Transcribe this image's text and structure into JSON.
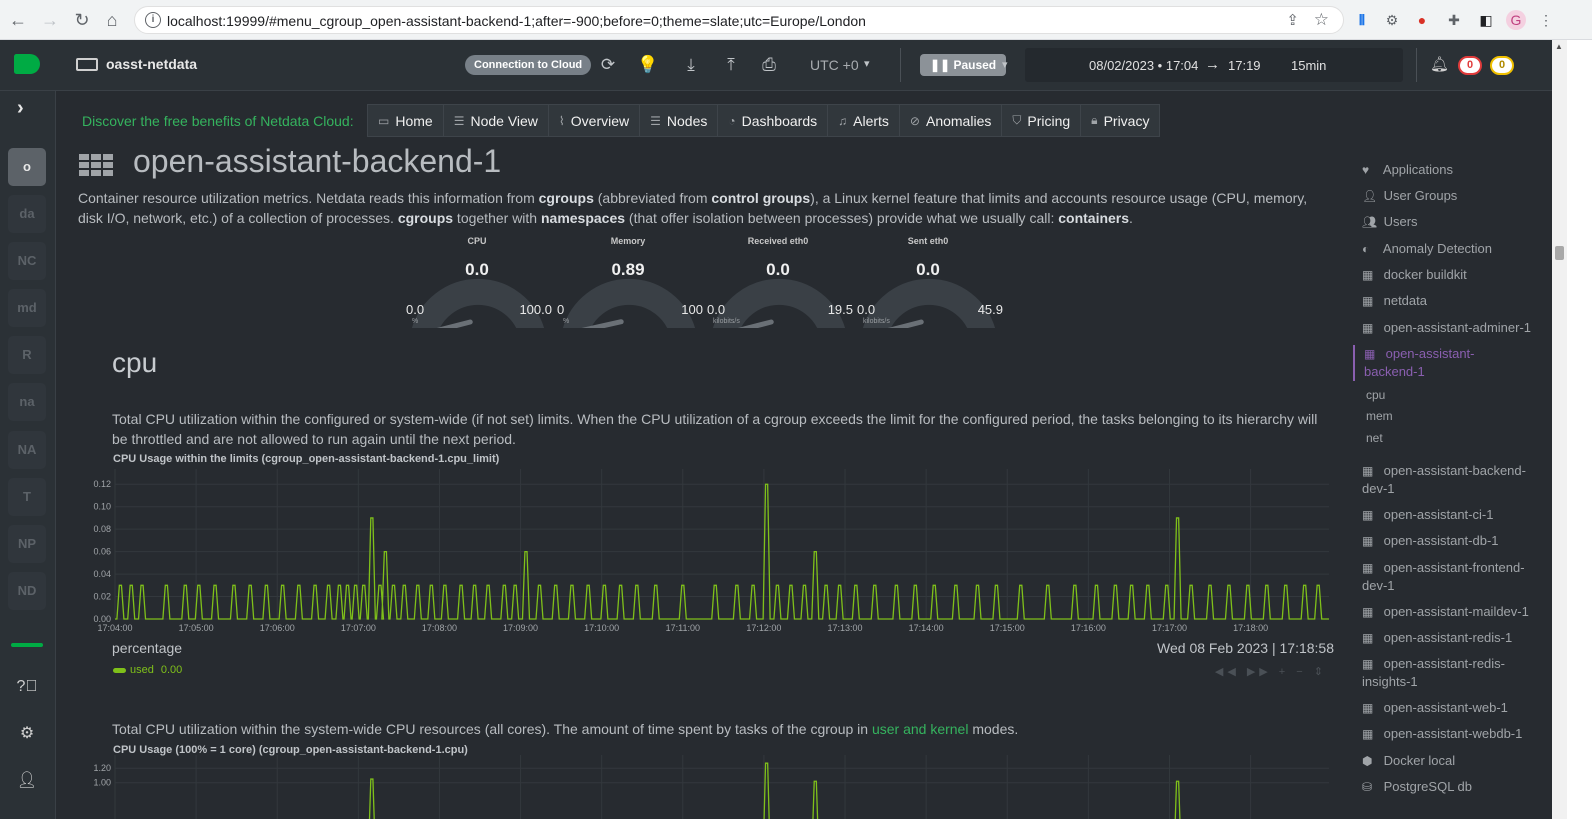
{
  "browser": {
    "url": "localhost:19999/#menu_cgroup_open-assistant-backend-1;after=-900;before=0;theme=slate;utc=Europe/London",
    "back_icon": "arrow-left-icon",
    "forward_icon": "arrow-right-icon",
    "reload_icon": "reload-icon",
    "home_icon": "home-icon"
  },
  "header": {
    "hostname": "oasst-netdata",
    "cloud_button": "Connection to Cloud",
    "timezone": "UTC +0",
    "paused_label": "Paused",
    "date_from": "08/02/2023 • 17:04",
    "arrow": "→",
    "date_to": "17:19",
    "duration": "15min",
    "alerts_critical": "0",
    "alerts_warning": "0"
  },
  "left_sidebar": {
    "nodes": [
      "o",
      "da",
      "NC",
      "md",
      "R",
      "na",
      "NA",
      "T",
      "NP",
      "ND"
    ]
  },
  "promo": "Discover the free benefits of Netdata Cloud:",
  "top_nav": [
    {
      "label": "Home",
      "icon": "monitor-icon"
    },
    {
      "label": "Node View",
      "icon": "server-icon"
    },
    {
      "label": "Overview",
      "icon": "chart-icon"
    },
    {
      "label": "Nodes",
      "icon": "nodes-icon"
    },
    {
      "label": "Dashboards",
      "icon": "dashboard-icon"
    },
    {
      "label": "Alerts",
      "icon": "bell-icon"
    },
    {
      "label": "Anomalies",
      "icon": "anomaly-icon"
    },
    {
      "label": "Pricing",
      "icon": "shield-icon"
    },
    {
      "label": "Privacy",
      "icon": "lock-icon"
    }
  ],
  "section": {
    "title": "open-assistant-backend-1",
    "desc_1": "Container resource utilization metrics. Netdata reads this information from ",
    "desc_b1": "cgroups",
    "desc_2": " (abbreviated from ",
    "desc_b2": "control groups",
    "desc_3": "), a Linux kernel feature that limits and accounts resource usage (CPU, memory, disk I/O, network, etc.) of a collection of processes. ",
    "desc_b3": "cgroups",
    "desc_4": " together with ",
    "desc_b4": "namespaces",
    "desc_5": " (that offer isolation between processes) provide what we usually call: ",
    "desc_b5": "containers",
    "desc_6": "."
  },
  "gauges": [
    {
      "title": "CPU",
      "value": "0.0",
      "min": "0.0",
      "max": "100.0",
      "unit": "%",
      "fill": 0.0
    },
    {
      "title": "Memory",
      "value": "0.89",
      "min": "0",
      "max": "100",
      "unit": "%",
      "fill": 0.0089
    },
    {
      "title": "Received eth0",
      "value": "0.0",
      "min": "0.0",
      "max": "19.5",
      "unit": "kilobits/s",
      "fill": 0.0
    },
    {
      "title": "Sent eth0",
      "value": "0.0",
      "min": "0.0",
      "max": "45.9",
      "unit": "kilobits/s",
      "fill": 0.0
    }
  ],
  "cpu_heading": "cpu",
  "chart1": {
    "desc": "Total CPU utilization within the configured or system-wide (if not set) limits. When the CPU utilization of a cgroup exceeds the limit for the configured period, the tasks belonging to its hierarchy will be throttled and are not allowed to run again until the next period.",
    "title": "CPU Usage within the limits (cgroup_open-assistant-backend-1.cpu_limit)",
    "unit": "percentage",
    "timestamp": "Wed 08 Feb 2023 | 17:18:58",
    "series_label": "used",
    "series_value": "0.00",
    "tools": "◀◀ ▶▶ + − ⇕"
  },
  "chart2": {
    "desc_1": "Total CPU utilization within the system-wide CPU resources (all cores). The amount of time spent by tasks of the cgroup in ",
    "desc_link": "user and kernel",
    "desc_2": " modes.",
    "title": "CPU Usage (100% = 1 core) (cgroup_open-assistant-backend-1.cpu)"
  },
  "chart_data": [
    {
      "type": "line",
      "title": "CPU Usage within the limits (cgroup_open-assistant-backend-1.cpu_limit)",
      "ylabel": "percentage",
      "ylim": [
        0,
        0.13
      ],
      "y_ticks": [
        "0.12",
        "0.10",
        "0.08",
        "0.06",
        "0.04",
        "0.02",
        "0.00"
      ],
      "x_ticks": [
        "17:04:00",
        "17:05:00",
        "17:06:00",
        "17:07:00",
        "17:08:00",
        "17:09:00",
        "17:10:00",
        "17:11:00",
        "17:12:00",
        "17:13:00",
        "17:14:00",
        "17:15:00",
        "17:16:00",
        "17:17:00",
        "17:18:00"
      ],
      "grid": true,
      "series": [
        {
          "name": "used",
          "color": "#7fc01a",
          "spikes": [
            {
              "t": "17:04:04",
              "v": 0.03
            },
            {
              "t": "17:04:12",
              "v": 0.03
            },
            {
              "t": "17:04:20",
              "v": 0.03
            },
            {
              "t": "17:04:38",
              "v": 0.03
            },
            {
              "t": "17:04:52",
              "v": 0.03
            },
            {
              "t": "17:05:02",
              "v": 0.03
            },
            {
              "t": "17:05:14",
              "v": 0.03
            },
            {
              "t": "17:05:28",
              "v": 0.03
            },
            {
              "t": "17:05:40",
              "v": 0.03
            },
            {
              "t": "17:05:52",
              "v": 0.03
            },
            {
              "t": "17:06:04",
              "v": 0.03
            },
            {
              "t": "17:06:16",
              "v": 0.03
            },
            {
              "t": "17:06:28",
              "v": 0.03
            },
            {
              "t": "17:06:38",
              "v": 0.03
            },
            {
              "t": "17:06:46",
              "v": 0.03
            },
            {
              "t": "17:06:52",
              "v": 0.03
            },
            {
              "t": "17:06:58",
              "v": 0.03
            },
            {
              "t": "17:07:04",
              "v": 0.03
            },
            {
              "t": "17:07:10",
              "v": 0.09
            },
            {
              "t": "17:07:16",
              "v": 0.03
            },
            {
              "t": "17:07:20",
              "v": 0.06
            },
            {
              "t": "17:07:26",
              "v": 0.03
            },
            {
              "t": "17:07:34",
              "v": 0.03
            },
            {
              "t": "17:07:44",
              "v": 0.03
            },
            {
              "t": "17:07:54",
              "v": 0.03
            },
            {
              "t": "17:08:04",
              "v": 0.03
            },
            {
              "t": "17:08:16",
              "v": 0.03
            },
            {
              "t": "17:08:26",
              "v": 0.03
            },
            {
              "t": "17:08:36",
              "v": 0.03
            },
            {
              "t": "17:08:48",
              "v": 0.03
            },
            {
              "t": "17:08:56",
              "v": 0.03
            },
            {
              "t": "17:09:04",
              "v": 0.06
            },
            {
              "t": "17:09:14",
              "v": 0.03
            },
            {
              "t": "17:09:26",
              "v": 0.03
            },
            {
              "t": "17:09:38",
              "v": 0.03
            },
            {
              "t": "17:09:50",
              "v": 0.03
            },
            {
              "t": "17:10:02",
              "v": 0.03
            },
            {
              "t": "17:10:14",
              "v": 0.03
            },
            {
              "t": "17:10:26",
              "v": 0.03
            },
            {
              "t": "17:10:40",
              "v": 0.03
            },
            {
              "t": "17:11:00",
              "v": 0.03
            },
            {
              "t": "17:11:24",
              "v": 0.03
            },
            {
              "t": "17:11:40",
              "v": 0.03
            },
            {
              "t": "17:11:52",
              "v": 0.03
            },
            {
              "t": "17:12:02",
              "v": 0.12
            },
            {
              "t": "17:12:10",
              "v": 0.03
            },
            {
              "t": "17:12:20",
              "v": 0.03
            },
            {
              "t": "17:12:30",
              "v": 0.03
            },
            {
              "t": "17:12:38",
              "v": 0.06
            },
            {
              "t": "17:12:46",
              "v": 0.03
            },
            {
              "t": "17:12:56",
              "v": 0.03
            },
            {
              "t": "17:13:08",
              "v": 0.03
            },
            {
              "t": "17:13:22",
              "v": 0.03
            },
            {
              "t": "17:13:38",
              "v": 0.03
            },
            {
              "t": "17:13:52",
              "v": 0.03
            },
            {
              "t": "17:14:06",
              "v": 0.03
            },
            {
              "t": "17:14:22",
              "v": 0.03
            },
            {
              "t": "17:14:38",
              "v": 0.03
            },
            {
              "t": "17:14:52",
              "v": 0.03
            },
            {
              "t": "17:15:10",
              "v": 0.03
            },
            {
              "t": "17:15:30",
              "v": 0.03
            },
            {
              "t": "17:15:50",
              "v": 0.03
            },
            {
              "t": "17:16:06",
              "v": 0.03
            },
            {
              "t": "17:16:20",
              "v": 0.03
            },
            {
              "t": "17:16:32",
              "v": 0.03
            },
            {
              "t": "17:16:44",
              "v": 0.03
            },
            {
              "t": "17:16:58",
              "v": 0.03
            },
            {
              "t": "17:17:06",
              "v": 0.09
            },
            {
              "t": "17:17:16",
              "v": 0.03
            },
            {
              "t": "17:17:30",
              "v": 0.03
            },
            {
              "t": "17:17:44",
              "v": 0.03
            },
            {
              "t": "17:17:58",
              "v": 0.03
            },
            {
              "t": "17:18:12",
              "v": 0.03
            },
            {
              "t": "17:18:26",
              "v": 0.03
            },
            {
              "t": "17:18:40",
              "v": 0.03
            },
            {
              "t": "17:18:50",
              "v": 0.03
            }
          ]
        }
      ]
    },
    {
      "type": "line",
      "title": "CPU Usage (100% = 1 core) (cgroup_open-assistant-backend-1.cpu)",
      "y_ticks": [
        "1.20",
        "1.00"
      ],
      "ylim": [
        0,
        1.3
      ],
      "grid": true,
      "series": [
        {
          "color": "#7fc01a",
          "spikes": [
            {
              "t": "17:07:10",
              "v": 1.05
            },
            {
              "t": "17:12:02",
              "v": 1.27
            },
            {
              "t": "17:12:38",
              "v": 1.02
            },
            {
              "t": "17:17:06",
              "v": 1.02
            }
          ]
        }
      ]
    }
  ],
  "right_sidebar": {
    "items": [
      {
        "label": "Applications",
        "icon": "heart-icon"
      },
      {
        "label": "User Groups",
        "icon": "user-icon"
      },
      {
        "label": "Users",
        "icon": "users-icon"
      },
      {
        "label": "Anomaly Detection",
        "icon": "anomaly-icon"
      },
      {
        "label": "docker buildkit",
        "icon": "grid-icon"
      },
      {
        "label": "netdata",
        "icon": "grid-icon"
      },
      {
        "label": "open-assistant-adminer-1",
        "icon": "grid-icon"
      }
    ],
    "active_line1": "open-assistant-",
    "active_line2": "backend-1",
    "sub_items": [
      "cpu",
      "mem",
      "net"
    ],
    "items2": [
      {
        "l1": "open-assistant-backend-",
        "l2": "dev-1"
      },
      {
        "l1": "open-assistant-ci-1",
        "l2": ""
      },
      {
        "l1": "open-assistant-db-1",
        "l2": ""
      },
      {
        "l1": "open-assistant-frontend-",
        "l2": "dev-1"
      },
      {
        "l1": "open-assistant-maildev-1",
        "l2": ""
      },
      {
        "l1": "open-assistant-redis-1",
        "l2": ""
      },
      {
        "l1": "open-assistant-redis-",
        "l2": "insights-1"
      },
      {
        "l1": "open-assistant-web-1",
        "l2": ""
      },
      {
        "l1": "open-assistant-webdb-1",
        "l2": ""
      }
    ],
    "items3": [
      {
        "label": "Docker local",
        "icon": "box-icon"
      },
      {
        "label": "PostgreSQL db",
        "icon": "database-icon"
      }
    ]
  }
}
